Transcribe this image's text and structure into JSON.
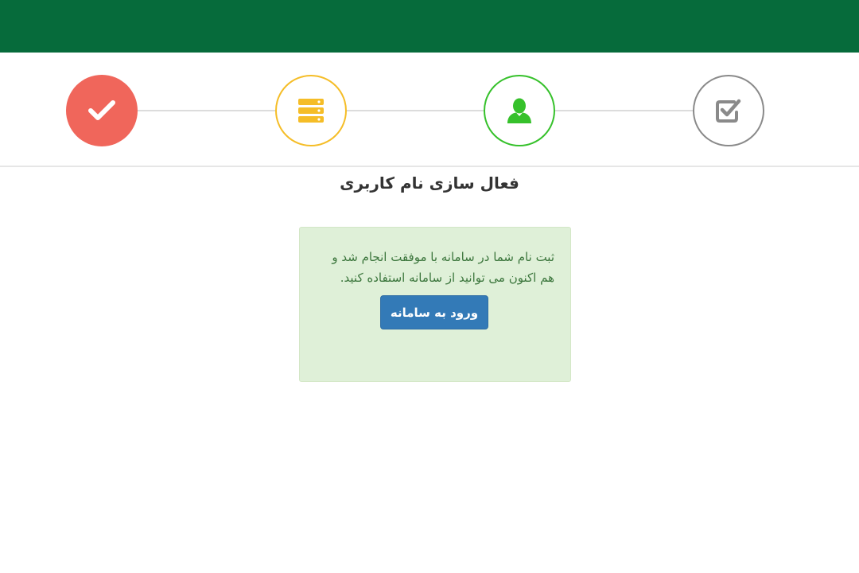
{
  "header": {
    "color": "#066b3b"
  },
  "steps": [
    {
      "icon": "checkmark-icon",
      "state": "completed",
      "color": "#f0665b"
    },
    {
      "icon": "database-icon",
      "state": "completed",
      "color": "#f5bd27"
    },
    {
      "icon": "user-icon",
      "state": "completed",
      "color": "#36c12b"
    },
    {
      "icon": "checkbox-icon",
      "state": "pending",
      "color": "#8a8a8a"
    }
  ],
  "main": {
    "title": "فعال سازی نام کاربری",
    "alert": {
      "message": "ثبت نام شما در سامانه با موفقت انجام شد و هم اکنون می توانید از سامانه استفاده کنید.",
      "button_label": "ورود به سامانه",
      "background": "#dff0d8",
      "button_color": "#337ab7"
    }
  }
}
